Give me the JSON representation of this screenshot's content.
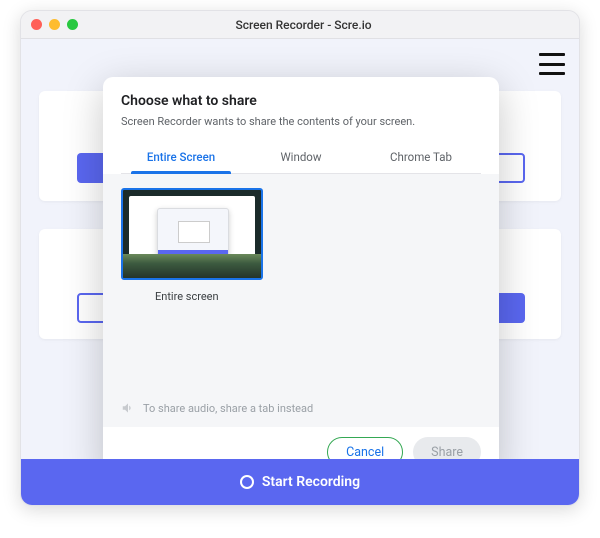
{
  "window": {
    "title": "Screen Recorder - Scre.io"
  },
  "footer": {
    "start_recording": "Start Recording"
  },
  "modal": {
    "title": "Choose what to share",
    "subtitle": "Screen Recorder wants to share the contents of your screen.",
    "tabs": {
      "entire_screen": "Entire Screen",
      "window": "Window",
      "chrome_tab": "Chrome Tab"
    },
    "thumb_label": "Entire screen",
    "audio_note": "To share audio, share a tab instead",
    "cancel": "Cancel",
    "share": "Share"
  }
}
